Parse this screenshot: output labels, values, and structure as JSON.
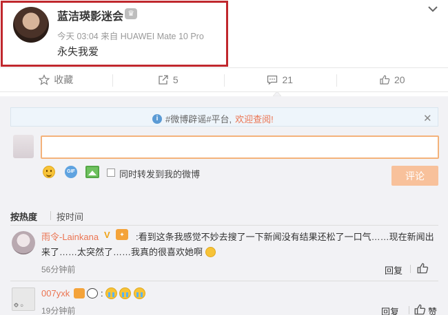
{
  "post": {
    "username": "蓝洁瑛影迷会",
    "meta": "今天 03:04 来自 HUAWEI Mate 10 Pro",
    "text": "永失我爱"
  },
  "actions": {
    "favorite": "收藏",
    "repost": "5",
    "comment": "21",
    "like": "20"
  },
  "notice": {
    "tag": "#微博辟谣#平台,",
    "link": "欢迎查阅!"
  },
  "composer": {
    "repost_label": "同时转发到我的微博",
    "submit_label": "评论"
  },
  "sort": {
    "hot": "按热度",
    "time": "按时间"
  },
  "comments": [
    {
      "name": "雨令-Lainkana",
      "text": ":看到这条我感觉不妙去搜了一下新闻没有结果还松了一口气……现在新闻出来了……太突然了……我真的很喜欢她啊",
      "time": "56分钟前",
      "reply": "回复"
    },
    {
      "name": "007yxk",
      "colon": ":",
      "time": "19分钟前",
      "reply": "回复",
      "like": "赞"
    }
  ]
}
